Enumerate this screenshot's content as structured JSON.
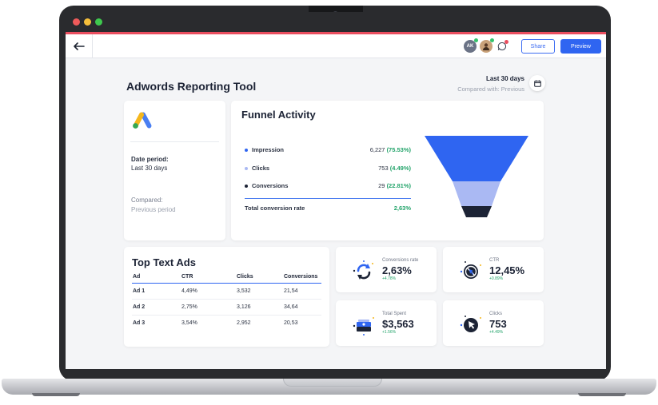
{
  "window": {
    "traffic_colors": [
      "#ee5a5a",
      "#f6bf3b",
      "#3ec94e"
    ]
  },
  "toolbar": {
    "back_icon": "arrow-left-icon",
    "avatar_initials": "AK",
    "share_label": "Share",
    "preview_label": "Preview"
  },
  "page": {
    "title": "Adwords Reporting Tool",
    "period": "Last 30 days",
    "compared_with": "Compared with: Previous"
  },
  "summary": {
    "date_period_label": "Date period:",
    "date_period_value": "Last 30 days",
    "compared_label": "Compared:",
    "compared_value": "Previous period"
  },
  "funnel": {
    "title": "Funnel Activity",
    "rows": [
      {
        "name": "Impression",
        "value": "6,227",
        "pct": "(75.53%)",
        "color": "#2f65f1"
      },
      {
        "name": "Clicks",
        "value": "753",
        "pct": "(4.49%)",
        "color": "#aab9f3"
      },
      {
        "name": "Conversions",
        "value": "29",
        "pct": "(22.81%)",
        "color": "#1c2335"
      }
    ],
    "total_label": "Total conversion rate",
    "total_value": "2,63%"
  },
  "top_ads": {
    "title": "Top Text Ads",
    "columns": [
      "Ad",
      "CTR",
      "Clicks",
      "Conversions"
    ],
    "rows": [
      [
        "Ad 1",
        "4,49%",
        "3,532",
        "21,54"
      ],
      [
        "Ad 2",
        "2,75%",
        "3,126",
        "34,64"
      ],
      [
        "Ad 3",
        "3,54%",
        "2,952",
        "20,53"
      ]
    ]
  },
  "kpis": {
    "conv_rate": {
      "label": "Conversions rate",
      "value": "2,63%",
      "delta": "+4.78%",
      "icon": "refresh-arrows-icon"
    },
    "ctr": {
      "label": "CTR",
      "value": "12,45%",
      "delta": "+0.89%",
      "icon": "no-click-icon"
    },
    "spent": {
      "label": "Total Spent",
      "value": "$3,563",
      "delta": "+1.56%",
      "icon": "money-stack-icon"
    },
    "clicks": {
      "label": "Clicks",
      "value": "753",
      "delta": "+4.49%",
      "icon": "cursor-click-icon"
    }
  },
  "colors": {
    "accent": "#2f65f1",
    "positive": "#24a46b",
    "dark": "#1c2335"
  }
}
